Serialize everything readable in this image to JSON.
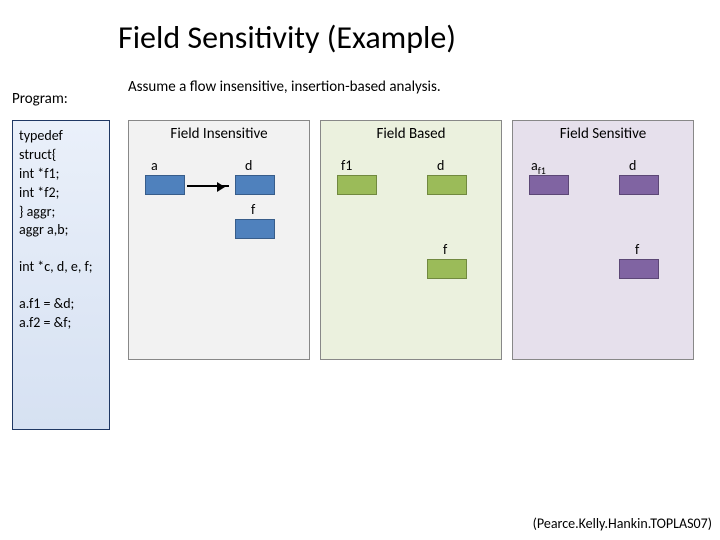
{
  "title": "Field Sensitivity (Example)",
  "assume": "Assume a flow insensitive, insertion-based analysis.",
  "program_label": "Program:",
  "code": {
    "block1": [
      "typedef",
      "struct{",
      "int *f1;",
      " int *f2;",
      "} aggr;",
      "aggr a,b;"
    ],
    "block2": [
      "int *c, d, e, f;"
    ],
    "block3": [
      "a.f1 = &d;",
      "a.f2 = &f;"
    ]
  },
  "panels": {
    "insensitive": {
      "title": "Field Insensitive",
      "labels": {
        "a": "a",
        "d": "d",
        "f": "f"
      }
    },
    "based": {
      "title": "Field Based",
      "labels": {
        "f1": "f1",
        "d": "d",
        "f": "f"
      }
    },
    "sensitive": {
      "title": "Field Sensitive",
      "labels": {
        "af1_a": "a",
        "af1_f1": "f1",
        "d": "d",
        "f": "f"
      }
    }
  },
  "citation": "(Pearce.Kelly.Hankin.TOPLAS07)"
}
